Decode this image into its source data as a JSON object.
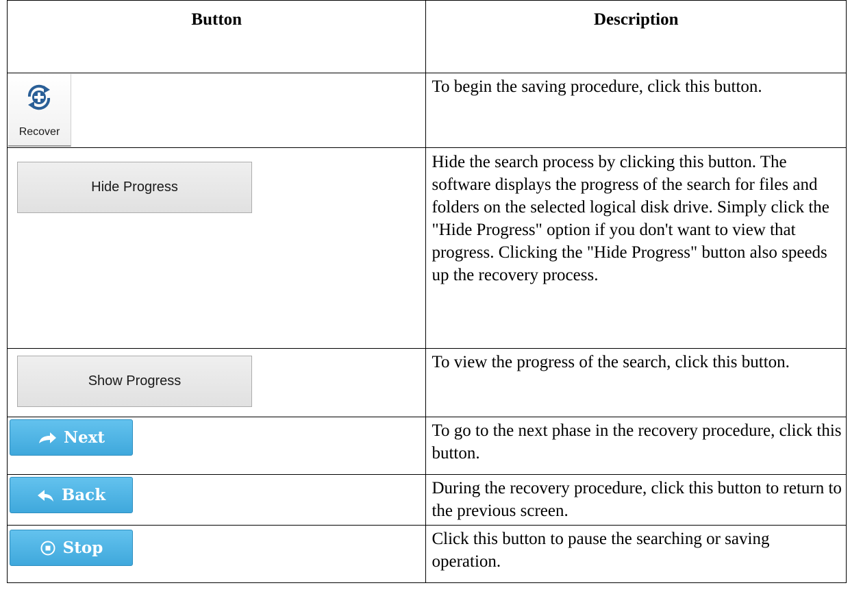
{
  "table": {
    "headers": [
      "Button",
      "Description"
    ],
    "rows": [
      {
        "button_label": "Recover",
        "icon": "recover-icon",
        "description": "To begin the saving procedure, click this button."
      },
      {
        "button_label": "Hide Progress",
        "description": "Hide the search process by clicking this button. The software displays the progress of the search for files and folders on the selected logical disk drive. Simply click the \"Hide Progress\" option if you don't want to view that progress. Clicking the \"Hide Progress\" button also speeds up the recovery process."
      },
      {
        "button_label": "Show Progress",
        "description": "To view the progress of the search, click this button."
      },
      {
        "button_label": "Next",
        "icon": "arrow-right-icon",
        "description": "To go to the next phase in the recovery procedure, click this button."
      },
      {
        "button_label": "Back",
        "icon": "arrow-back-icon",
        "description": "During the recovery procedure, click this button to return to the previous screen."
      },
      {
        "button_label": "Stop",
        "icon": "stop-icon",
        "description": "Click this button to pause the searching or saving operation."
      }
    ]
  },
  "colors": {
    "blue_button": "#4fb4e6",
    "grey_button": "#e6e6e6",
    "recover_icon": "#2a5f97"
  }
}
